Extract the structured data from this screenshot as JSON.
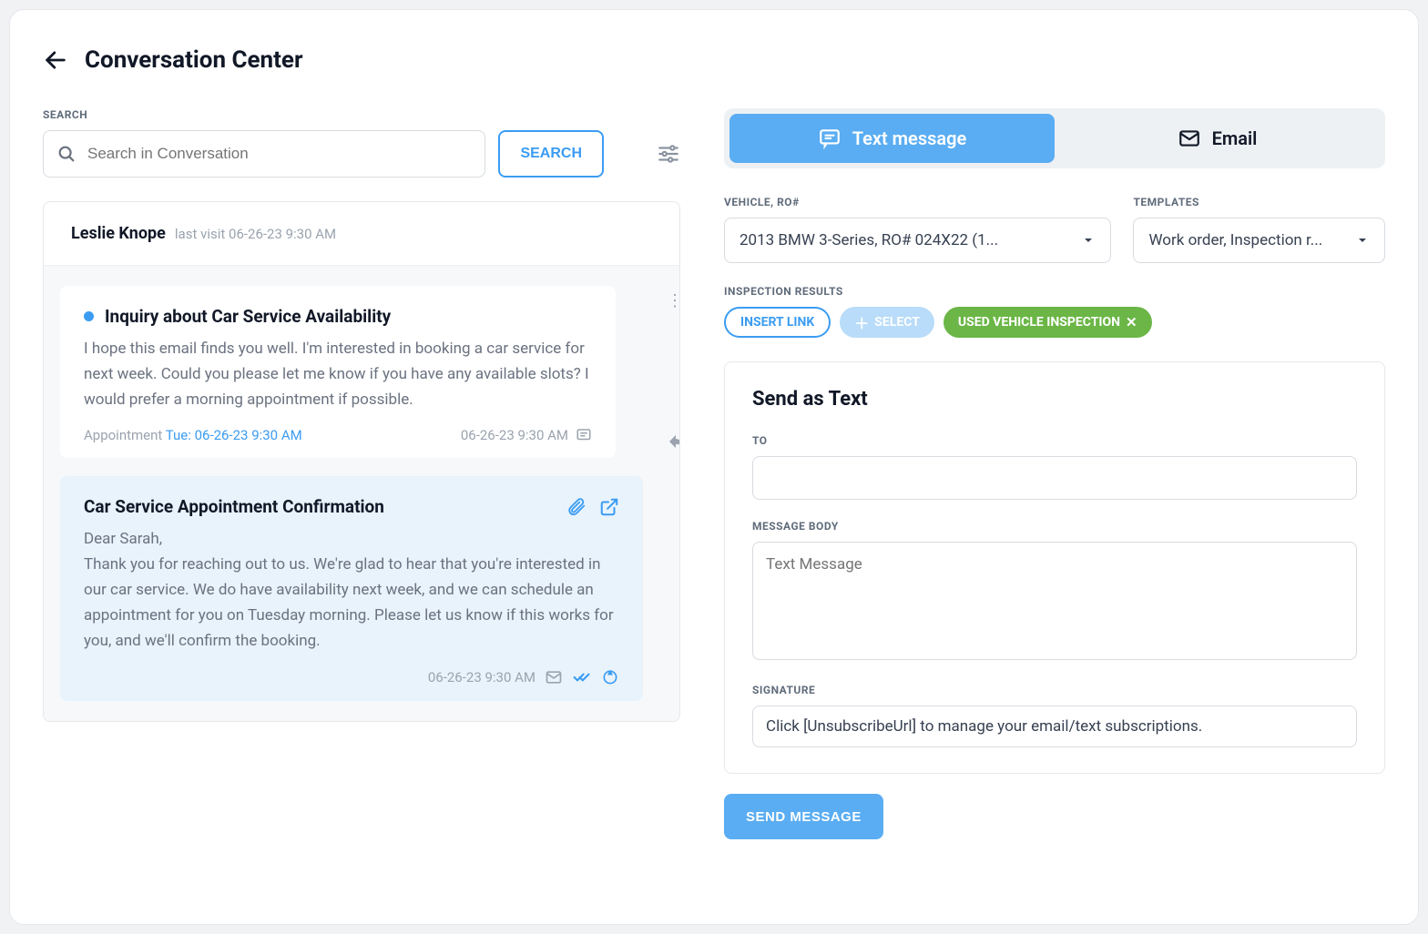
{
  "header": {
    "title": "Conversation Center"
  },
  "search": {
    "label": "SEARCH",
    "placeholder": "Search in Conversation",
    "button": "SEARCH"
  },
  "conversation": {
    "customer": "Leslie Knope",
    "last_visit": "last visit 06-26-23 9:30 AM",
    "messages": [
      {
        "subject": "Inquiry about Car Service Availability",
        "body": "I hope this email finds you well. I'm interested in booking a car service for next week. Could you please let me know if you have any available slots? I would prefer a morning appointment if possible.",
        "appointment_label": "Appointment",
        "appointment_time": "Tue: 06-26-23 9:30 AM",
        "timestamp": "06-26-23 9:30 AM"
      },
      {
        "subject": "Car Service Appointment Confirmation",
        "salutation": "Dear Sarah,",
        "body": "Thank you for reaching out to us. We're glad to hear that you're interested in our car service. We do have availability next week, and we can schedule an appointment for you on Tuesday morning. Please let us know if this works for you, and we'll confirm the booking.",
        "timestamp": "06-26-23 9:30 AM"
      }
    ]
  },
  "composer": {
    "tabs": {
      "text": "Text message",
      "email": "Email"
    },
    "vehicle_label": "VEHICLE, RO#",
    "vehicle_value": "2013 BMW 3-Series, RO# 024X22 (1...",
    "template_label": "TEMPLATES",
    "template_value": "Work order, Inspection r...",
    "inspection_label": "INSPECTION RESULTS",
    "chip_insert": "INSERT LINK",
    "chip_select": "SELECT",
    "chip_tag": "USED VEHICLE INSPECTION",
    "panel_title": "Send as Text",
    "to_label": "TO",
    "body_label": "MESSAGE BODY",
    "body_placeholder": "Text Message",
    "signature_label": "SIGNATURE",
    "signature_value": "Click [UnsubscribeUrl] to manage your email/text subscriptions.",
    "send_button": "SEND MESSAGE"
  }
}
